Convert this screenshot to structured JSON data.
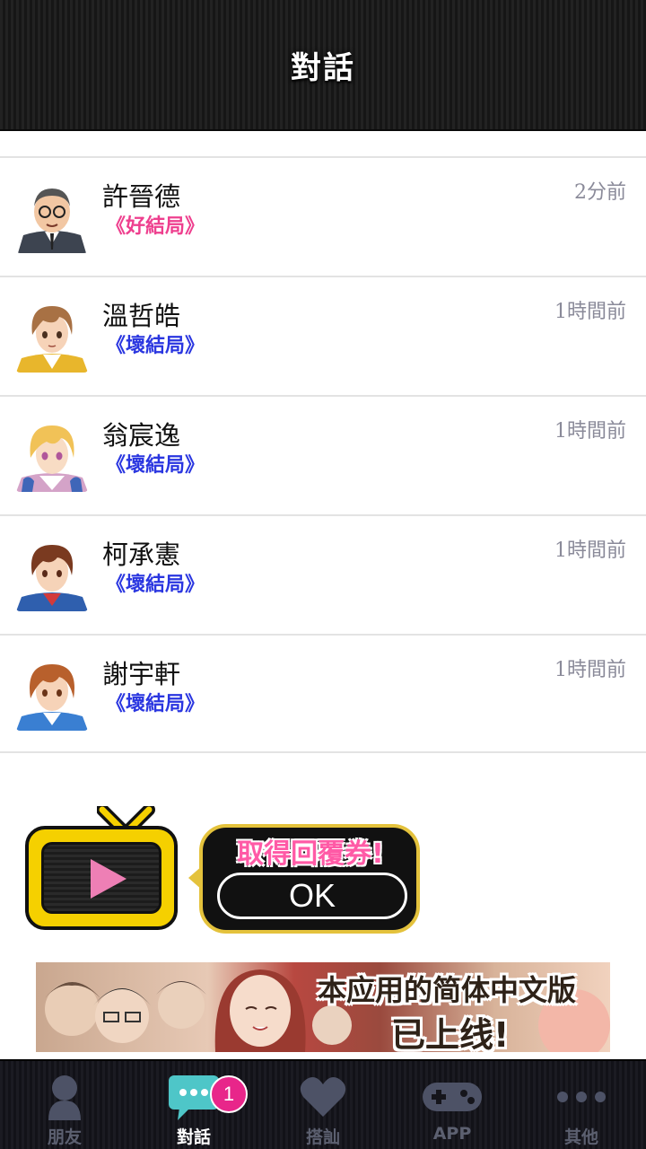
{
  "header": {
    "title": "對話"
  },
  "conversations": [
    {
      "name": "許晉德",
      "ending": "《好結局》",
      "ending_color": "#ee3f8e",
      "time": "2分前",
      "avatar": "avatar-older-man-glasses"
    },
    {
      "name": "溫哲皓",
      "ending": "《壞結局》",
      "ending_color": "#2a36e0",
      "time": "1時間前",
      "avatar": "avatar-brown-hair-boy"
    },
    {
      "name": "翁宸逸",
      "ending": "《壞結局》",
      "ending_color": "#2a36e0",
      "time": "1時間前",
      "avatar": "avatar-blonde-boy"
    },
    {
      "name": "柯承憲",
      "ending": "《壞結局》",
      "ending_color": "#2a36e0",
      "time": "1時間前",
      "avatar": "avatar-dark-brown-hair-boy"
    },
    {
      "name": "謝宇軒",
      "ending": "《壞結局》",
      "ending_color": "#2a36e0",
      "time": "1時間前",
      "avatar": "avatar-auburn-hair-boy"
    }
  ],
  "reward": {
    "title": "取得回覆券!",
    "ok_label": "OK",
    "icon": "tv-play-icon"
  },
  "ad": {
    "line1": "本应用的简体中文版",
    "line2": "已上线!"
  },
  "tabbar": {
    "tabs": [
      {
        "label": "朋友",
        "icon": "person-icon"
      },
      {
        "label": "對話",
        "icon": "chat-bubble-icon",
        "badge": "1",
        "active": true
      },
      {
        "label": "搭訕",
        "icon": "heart-icon"
      },
      {
        "label": "APP",
        "icon": "gamepad-icon"
      },
      {
        "label": "其他",
        "icon": "more-dots-icon"
      }
    ]
  },
  "colors": {
    "header_bg": "#1c1c1c",
    "badge": "#e8268a",
    "good_ending": "#ee3f8e",
    "bad_ending": "#2a36e0"
  }
}
